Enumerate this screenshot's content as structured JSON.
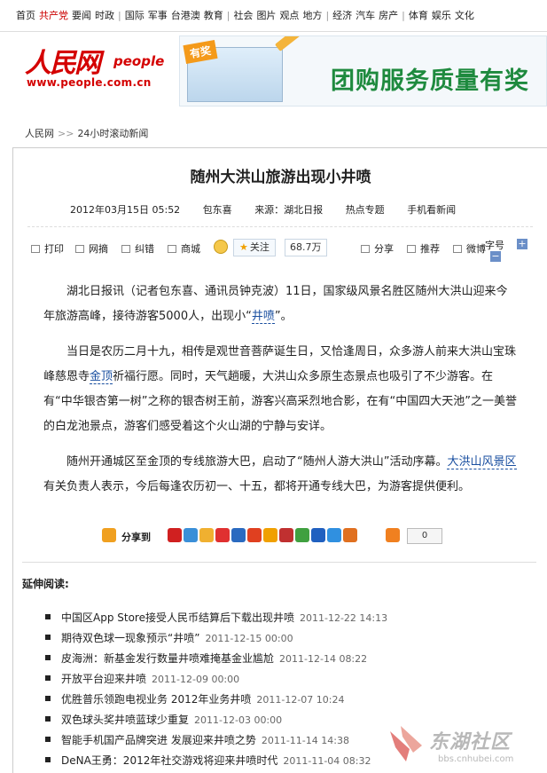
{
  "topnav": {
    "items": [
      "首页",
      "共产党",
      "要闻",
      "时政",
      "国际",
      "军事",
      "台港澳",
      "教育",
      "社会",
      "图片",
      "观点",
      "地方",
      "经济",
      "汽车",
      "房产",
      "体育",
      "娱乐",
      "文化"
    ]
  },
  "header": {
    "logo_cn": "人民网",
    "logo_en": "people",
    "logo_url": "www.people.com.cn",
    "banner_tag": "有奖",
    "banner_slogan": "团购服务质量有奖"
  },
  "breadcrumb": {
    "home": "人民网",
    "arrow": ">>",
    "current": "24小时滚动新闻"
  },
  "article": {
    "title": "随州大洪山旅游出现小井喷",
    "date": "2012年03月15日 05:52",
    "author": "包东喜",
    "source": "来源：湖北日报",
    "hot": "热点专题",
    "mobile": "手机看新闻",
    "p1_a": "湖北日报讯（记者包东喜、通讯员钟克波）11日，国家级风景名胜区随州大洪山迎来今年旅游高峰，接待游客5000人，出现小“",
    "p1_kw": "井喷",
    "p1_b": "”。",
    "p2_a": "当日是农历二月十九，相传是观世音菩萨诞生日，又恰逢周日，众多游人前来大洪山宝珠峰慈恩寺",
    "p2_kw": "金顶",
    "p2_b": "祈福行愿。同时，天气趟暖，大洪山众多原生态景点也吸引了不少游客。在有“中华银杏第一树”之称的银杏树王前，游客兴高采烈地合影，在有“中国四大天池”之一美誉的白龙池景点，游客们感受着这个火山湖的宁静与安详。",
    "p3_a": "随州开通城区至金顶的专线旅游大巴，启动了“随州人游大洪山”活动序幕。",
    "p3_kw": "大洪山风景区",
    "p3_b": "有关负责人表示，今后每逢农历初一、十五，都将开通专线大巴，为游客提供便利。"
  },
  "toolbar": {
    "print": "打印",
    "clip": "网摘",
    "error": "纠错",
    "mall": "商城",
    "follow": "关注",
    "count": "68.7万",
    "share": "分享",
    "recommend": "推荐",
    "weibo": "微博",
    "font": "字号",
    "plus": "+",
    "minus": "−"
  },
  "share_bar": {
    "label": "分享到",
    "count": "0"
  },
  "related": {
    "heading": "延伸阅读:",
    "items": [
      {
        "title": "中国区App Store接受人民币结算后下载出现井喷",
        "date": "2011-12-22 14:13"
      },
      {
        "title": "期待双色球一现象预示“井喷”",
        "date": "2011-12-15 00:00"
      },
      {
        "title": "皮海洲：新基金发行数量井喷难掩基金业尴尬",
        "date": "2011-12-14 08:22"
      },
      {
        "title": "开放平台迎来井喷",
        "date": "2011-12-09 00:00"
      },
      {
        "title": "优胜普乐领跑电视业务  2012年业务井喷",
        "date": "2011-12-07 10:24"
      },
      {
        "title": "双色球头奖井喷蓝球少重复",
        "date": "2011-12-03 00:00"
      },
      {
        "title": "智能手机国产品牌突进  发展迎来井喷之势",
        "date": "2011-11-14 14:38"
      },
      {
        "title": "DeNA王勇：2012年社交游戏将迎来井喷时代",
        "date": "2011-11-04 08:32"
      }
    ]
  },
  "watermark": {
    "name": "东湖社区",
    "url": "bbs.cnhubei.com"
  },
  "colors": {
    "brand": "#d40000",
    "link": "#1a4fa0",
    "banner_green": "#1e8a3e"
  }
}
